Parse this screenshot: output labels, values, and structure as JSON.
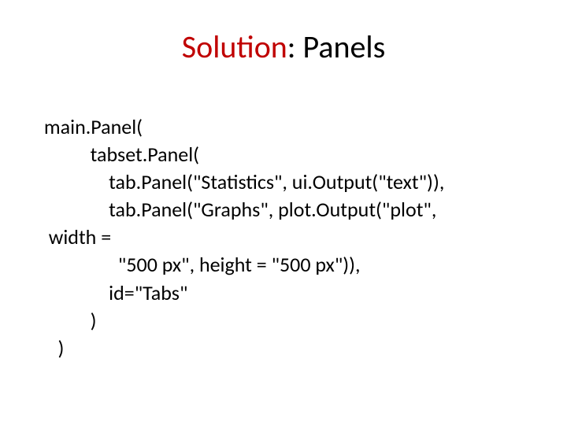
{
  "title": {
    "red": "Solution",
    "black": ": Panels"
  },
  "code": {
    "l1": " main.Panel(",
    "l2": "           tabset.Panel(",
    "l3": "               tab.Panel(\"Statistics\", ui.Output(\"text\")),",
    "l4": "               tab.Panel(\"Graphs\", plot.Output(\"plot\",",
    "l5": "  width =",
    "l6": "                 \"500 px\", height = \"500 px\")),",
    "l7": "               id=\"Tabs\"",
    "l8": "           )",
    "l9": "    )"
  }
}
